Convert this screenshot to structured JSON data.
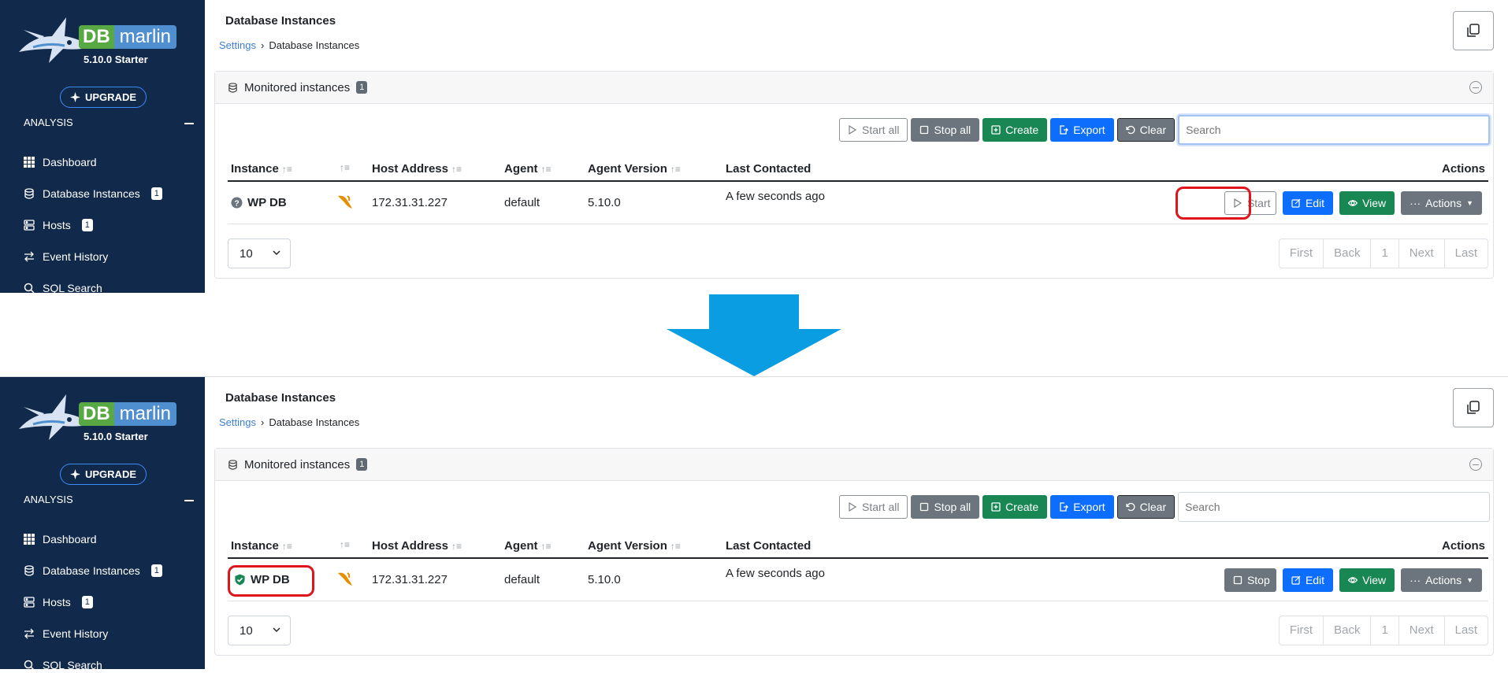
{
  "app": {
    "brand_db": "DB",
    "brand_marlin": "marlin",
    "version": "5.10.0 Starter",
    "upgrade_label": "UPGRADE"
  },
  "sidebar": {
    "section_label": "ANALYSIS",
    "items": [
      {
        "label": "Dashboard",
        "icon": "grid-icon",
        "badge": ""
      },
      {
        "label": "Database Instances",
        "icon": "database-icon",
        "badge": "1"
      },
      {
        "label": "Hosts",
        "icon": "server-icon",
        "badge": "1"
      },
      {
        "label": "Event History",
        "icon": "arrows-exchange-icon",
        "badge": ""
      },
      {
        "label": "SQL Search",
        "icon": "search-icon",
        "badge": ""
      }
    ]
  },
  "header": {
    "title": "Database Instances",
    "breadcrumb": [
      "Settings",
      "Database Instances"
    ]
  },
  "card": {
    "title": "Monitored instances",
    "count": "1"
  },
  "toolbar": {
    "start_all": "Start all",
    "stop_all": "Stop all",
    "create": "Create",
    "export": "Export",
    "clear": "Clear",
    "search_placeholder": "Search"
  },
  "table": {
    "columns": [
      "Instance",
      "Host Address",
      "Agent",
      "Agent Version",
      "Last Contacted",
      "Actions"
    ]
  },
  "before": {
    "row": {
      "instance": "WP DB",
      "status": "unknown",
      "host": "172.31.31.227",
      "agent": "default",
      "agent_version": "5.10.0",
      "last_contacted": "A few seconds ago",
      "toggle_label": "Start",
      "edit_label": "Edit",
      "view_label": "View",
      "actions_label": "Actions"
    }
  },
  "after": {
    "row": {
      "instance": "WP DB",
      "status": "monitored",
      "host": "172.31.31.227",
      "agent": "default",
      "agent_version": "5.10.0",
      "last_contacted": "A few seconds ago",
      "toggle_label": "Stop",
      "edit_label": "Edit",
      "view_label": "View",
      "actions_label": "Actions"
    }
  },
  "pagination": {
    "page_size": "10",
    "pages": [
      "First",
      "Back",
      "1",
      "Next",
      "Last"
    ]
  },
  "colors": {
    "sidebar_bg": "#11294a",
    "primary": "#0d6efd",
    "success": "#198754",
    "secondary": "#6c757d",
    "highlight": "#e0141b",
    "arrow": "#0a9de2"
  }
}
